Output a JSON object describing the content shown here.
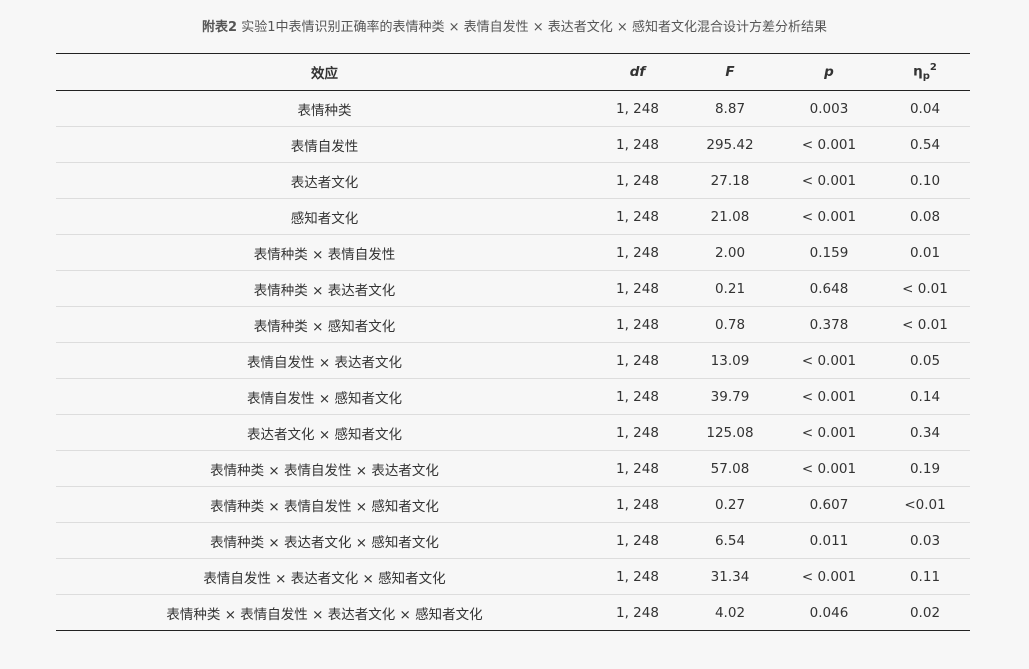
{
  "caption": {
    "label": "附表2",
    "text": " 实验1中表情识别正确率的表情种类 × 表情自发性 × 表达者文化 × 感知者文化混合设计方差分析结果"
  },
  "table": {
    "headers": {
      "effect": "效应",
      "df": "df",
      "F": "F",
      "p": "p",
      "eta_base": "η",
      "eta_sub": "p",
      "eta_sup": "2"
    },
    "rows": [
      {
        "effect": "表情种类",
        "df": "1, 248",
        "F": "8.87",
        "p": "0.003",
        "eta": "0.04"
      },
      {
        "effect": "表情自发性",
        "df": "1, 248",
        "F": "295.42",
        "p": "< 0.001",
        "eta": "0.54"
      },
      {
        "effect": "表达者文化",
        "df": "1, 248",
        "F": "27.18",
        "p": "< 0.001",
        "eta": "0.10"
      },
      {
        "effect": "感知者文化",
        "df": "1, 248",
        "F": "21.08",
        "p": "< 0.001",
        "eta": "0.08"
      },
      {
        "effect": "表情种类 × 表情自发性",
        "df": "1, 248",
        "F": "2.00",
        "p": "0.159",
        "eta": "0.01"
      },
      {
        "effect": "表情种类 × 表达者文化",
        "df": "1, 248",
        "F": "0.21",
        "p": "0.648",
        "eta": "< 0.01"
      },
      {
        "effect": "表情种类 × 感知者文化",
        "df": "1, 248",
        "F": "0.78",
        "p": "0.378",
        "eta": "< 0.01"
      },
      {
        "effect": "表情自发性 × 表达者文化",
        "df": "1, 248",
        "F": "13.09",
        "p": "< 0.001",
        "eta": "0.05"
      },
      {
        "effect": "表情自发性 × 感知者文化",
        "df": "1, 248",
        "F": "39.79",
        "p": "< 0.001",
        "eta": "0.14"
      },
      {
        "effect": "表达者文化 × 感知者文化",
        "df": "1, 248",
        "F": "125.08",
        "p": "< 0.001",
        "eta": "0.34"
      },
      {
        "effect": "表情种类 × 表情自发性 × 表达者文化",
        "df": "1, 248",
        "F": "57.08",
        "p": "< 0.001",
        "eta": "0.19"
      },
      {
        "effect": "表情种类 × 表情自发性 × 感知者文化",
        "df": "1, 248",
        "F": "0.27",
        "p": "0.607",
        "eta": "<0.01"
      },
      {
        "effect": "表情种类 × 表达者文化 × 感知者文化",
        "df": "1, 248",
        "F": "6.54",
        "p": "0.011",
        "eta": "0.03"
      },
      {
        "effect": "表情自发性 × 表达者文化 × 感知者文化",
        "df": "1, 248",
        "F": "31.34",
        "p": "< 0.001",
        "eta": "0.11"
      },
      {
        "effect": "表情种类 × 表情自发性 × 表达者文化 × 感知者文化",
        "df": "1, 248",
        "F": "4.02",
        "p": "0.046",
        "eta": "0.02"
      }
    ]
  }
}
